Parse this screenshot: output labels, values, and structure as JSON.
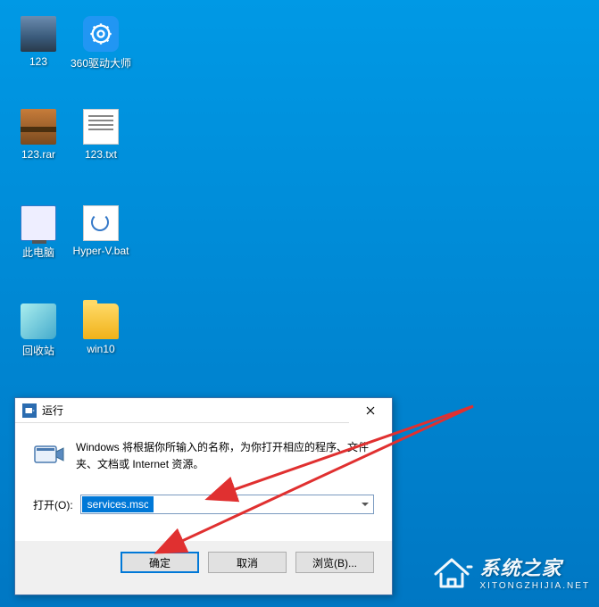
{
  "desktop": {
    "icons": [
      {
        "name": "folder-123",
        "label": "123"
      },
      {
        "name": "driver-app",
        "label": "360驱动大师"
      },
      {
        "name": "rar-file",
        "label": "123.rar"
      },
      {
        "name": "txt-file",
        "label": "123.txt"
      },
      {
        "name": "this-pc",
        "label": "此电脑"
      },
      {
        "name": "bat-file",
        "label": "Hyper-V.bat"
      },
      {
        "name": "recycle-bin",
        "label": "回收站"
      },
      {
        "name": "win10-folder",
        "label": "win10"
      }
    ]
  },
  "run_dialog": {
    "title": "运行",
    "description": "Windows 将根据你所输入的名称，为你打开相应的程序、文件夹、文档或 Internet 资源。",
    "open_label": "打开(O):",
    "input_value": "services.msc",
    "buttons": {
      "ok": "确定",
      "cancel": "取消",
      "browse": "浏览(B)..."
    }
  },
  "watermark": {
    "title": "系统之家",
    "subtitle": "XITONGZHIJIA.NET"
  }
}
